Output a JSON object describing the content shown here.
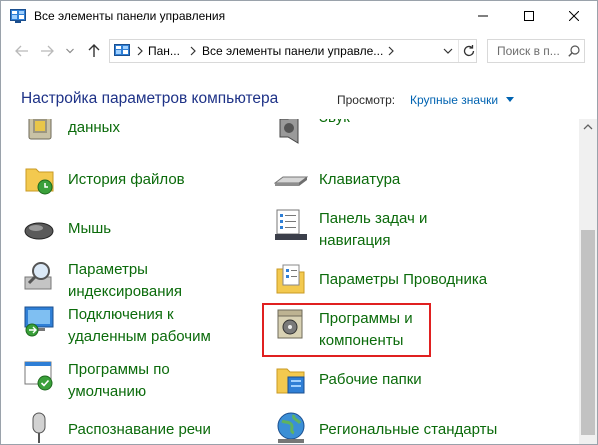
{
  "window": {
    "title": "Все элементы панели управления"
  },
  "address": {
    "segments": [
      "Пан...",
      "Все элементы панели управле...",
      ""
    ],
    "search_placeholder": "Поиск в п..."
  },
  "header": {
    "title": "Настройка параметров компьютера",
    "view_label": "Просмотр:",
    "view_value": "Крупные значки"
  },
  "items": [
    {
      "label_1": "данных",
      "label_2": "",
      "icon": "backup-icon"
    },
    {
      "label_1": "Звук",
      "label_2": "",
      "icon": "speaker-icon"
    },
    {
      "label_1": "История файлов",
      "label_2": "",
      "icon": "file-history-icon"
    },
    {
      "label_1": "Клавиатура",
      "label_2": "",
      "icon": "keyboard-icon"
    },
    {
      "label_1": "Мышь",
      "label_2": "",
      "icon": "mouse-icon"
    },
    {
      "label_1": "Панель задач и",
      "label_2": "навигация",
      "icon": "taskbar-icon"
    },
    {
      "label_1": "Параметры",
      "label_2": "индексирования",
      "icon": "indexing-icon"
    },
    {
      "label_1": "Параметры Проводника",
      "label_2": "",
      "icon": "explorer-options-icon"
    },
    {
      "label_1": "Подключения к",
      "label_2": "удаленным рабочим",
      "icon": "remote-desktop-icon"
    },
    {
      "label_1": "Программы и",
      "label_2": "компоненты",
      "icon": "programs-icon"
    },
    {
      "label_1": "Программы по",
      "label_2": "умолчанию",
      "icon": "default-programs-icon"
    },
    {
      "label_1": "Рабочие папки",
      "label_2": "",
      "icon": "work-folders-icon"
    },
    {
      "label_1": "Распознавание речи",
      "label_2": "",
      "icon": "microphone-icon"
    },
    {
      "label_1": "Региональные стандарты",
      "label_2": "",
      "icon": "globe-icon"
    }
  ],
  "colors": {
    "link": "#0b6b0b",
    "heading": "#1e3287",
    "accent": "#0063b1",
    "highlight": "#e02020"
  }
}
